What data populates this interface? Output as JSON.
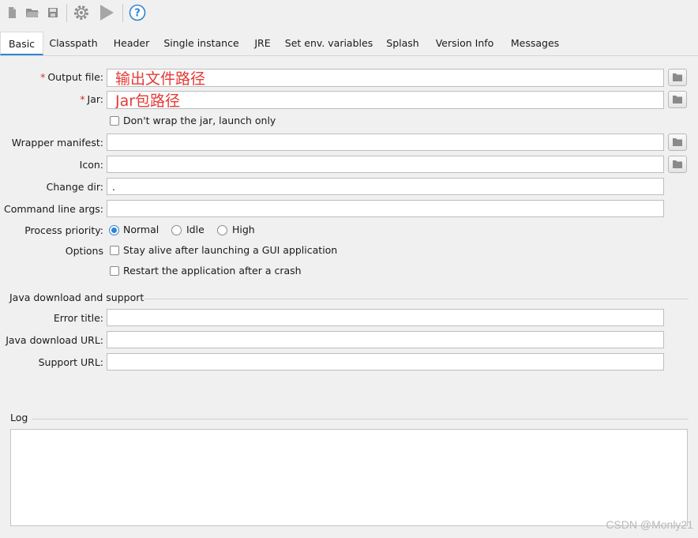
{
  "toolbar": {
    "icons": [
      "new-icon",
      "open-icon",
      "save-icon",
      "settings-icon",
      "run-icon",
      "help-icon"
    ]
  },
  "tabs": [
    {
      "label": "Basic",
      "active": true
    },
    {
      "label": "Classpath",
      "active": false
    },
    {
      "label": "Header",
      "active": false
    },
    {
      "label": "Single instance",
      "active": false
    },
    {
      "label": "JRE",
      "active": false
    },
    {
      "label": "Set env. variables",
      "active": false
    },
    {
      "label": "Splash",
      "active": false
    },
    {
      "label": "Version Info",
      "active": false
    },
    {
      "label": "Messages",
      "active": false
    }
  ],
  "form": {
    "required_mark": "*",
    "output_file": {
      "label": "Output file:",
      "value": "输出文件路径"
    },
    "jar": {
      "label": "Jar:",
      "value": "Jar包路径"
    },
    "dont_wrap": {
      "label": "Don't wrap the jar, launch only",
      "checked": false
    },
    "wrapper_manifest": {
      "label": "Wrapper manifest:",
      "value": ""
    },
    "icon": {
      "label": "Icon:",
      "value": ""
    },
    "change_dir": {
      "label": "Change dir:",
      "value": "."
    },
    "cmd_args": {
      "label": "Command line args:",
      "value": ""
    },
    "process_priority": {
      "label": "Process priority:",
      "options": [
        "Normal",
        "Idle",
        "High"
      ],
      "selected": "Normal"
    },
    "options": {
      "label": "Options",
      "stay_alive": {
        "label": "Stay alive after launching a GUI application",
        "checked": false
      },
      "restart": {
        "label": "Restart the application after a crash",
        "checked": false
      }
    }
  },
  "java_section": {
    "title": "Java download and support",
    "error_title": {
      "label": "Error title:",
      "value": ""
    },
    "download_url": {
      "label": "Java download URL:",
      "value": ""
    },
    "support_url": {
      "label": "Support URL:",
      "value": ""
    }
  },
  "log": {
    "title": "Log",
    "content": ""
  },
  "watermark": "CSDN @Monly21",
  "colors": {
    "accent": "#2e84d6",
    "annotation": "#e53935",
    "required": "#d32f2f"
  }
}
